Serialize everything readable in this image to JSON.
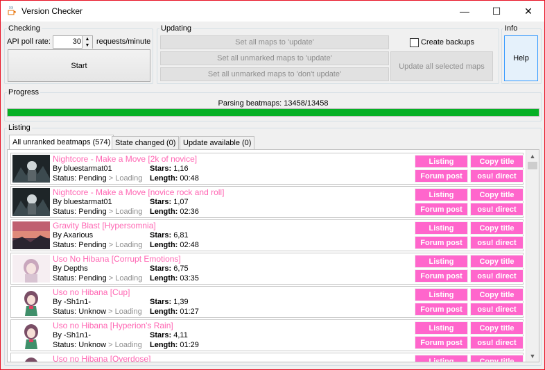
{
  "window": {
    "title": "Version Checker",
    "minimize_glyph": "—",
    "maximize_glyph": "☐",
    "close_glyph": "✕"
  },
  "checking": {
    "group_label": "Checking",
    "poll_label": "API poll rate:",
    "poll_value": "30",
    "poll_unit": "requests/minute",
    "start_label": "Start"
  },
  "updating": {
    "group_label": "Updating",
    "set_all_update": "Set all maps to 'update'",
    "set_unmarked_update": "Set all unmarked maps to 'update'",
    "set_unmarked_dont": "Set all unmarked maps to 'don't update'",
    "create_backups_label": "Create backups",
    "update_selected": "Update all selected maps"
  },
  "info": {
    "group_label": "Info",
    "help_label": "Help"
  },
  "progress": {
    "group_label": "Progress",
    "status_text": "Parsing beatmaps: 13458/13458",
    "fraction": 1.0,
    "color": "#06b025"
  },
  "listing": {
    "group_label": "Listing",
    "tabs": [
      {
        "label": "All unranked beatmaps (574)"
      },
      {
        "label": "State changed (0)"
      },
      {
        "label": "Update available (0)"
      }
    ],
    "button_labels": {
      "listing": "Listing",
      "copy_title": "Copy title",
      "forum_post": "Forum post",
      "osu_direct": "osu! direct"
    },
    "labels": {
      "by_prefix": "By ",
      "status_prefix": "Status: ",
      "loading": " > Loading",
      "stars": "Stars:",
      "length": "Length:"
    },
    "rows": [
      {
        "title": "Nightcore - Make a Move [2k of novice]",
        "mapper": "bluestarmat01",
        "status": "Pending",
        "stars": "1,16",
        "length": "00:48",
        "thumb": "dark-art"
      },
      {
        "title": "Nightcore - Make a Move [novice rock and roll]",
        "mapper": "bluestarmat01",
        "status": "Pending",
        "stars": "1,07",
        "length": "02:36",
        "thumb": "dark-art"
      },
      {
        "title": "Gravity Blast [Hypersomnia]",
        "mapper": "Axarious",
        "status": "Pending",
        "stars": "6,81",
        "length": "02:48",
        "thumb": "red-sky"
      },
      {
        "title": "Uso No Hibana [Corrupt Emotions]",
        "mapper": "Depths",
        "status": "Pending",
        "stars": "6,75",
        "length": "03:35",
        "thumb": "anime-pale"
      },
      {
        "title": "Uso no Hibana [Cup]",
        "mapper": "-Sh1n1-",
        "status": "Unknow",
        "stars": "1,39",
        "length": "01:27",
        "thumb": "anime-girl"
      },
      {
        "title": "Uso no Hibana [Hyperion's Rain]",
        "mapper": "-Sh1n1-",
        "status": "Unknow",
        "stars": "4,11",
        "length": "01:29",
        "thumb": "anime-girl"
      },
      {
        "title": "Uso no Hibana [Overdose]",
        "mapper": "",
        "status": "",
        "stars": "",
        "length": "",
        "thumb": "anime-girl"
      }
    ]
  },
  "colors": {
    "accent_pink": "#ff66cc",
    "title_pink": "#ff66b3",
    "progress_green": "#06b025"
  }
}
